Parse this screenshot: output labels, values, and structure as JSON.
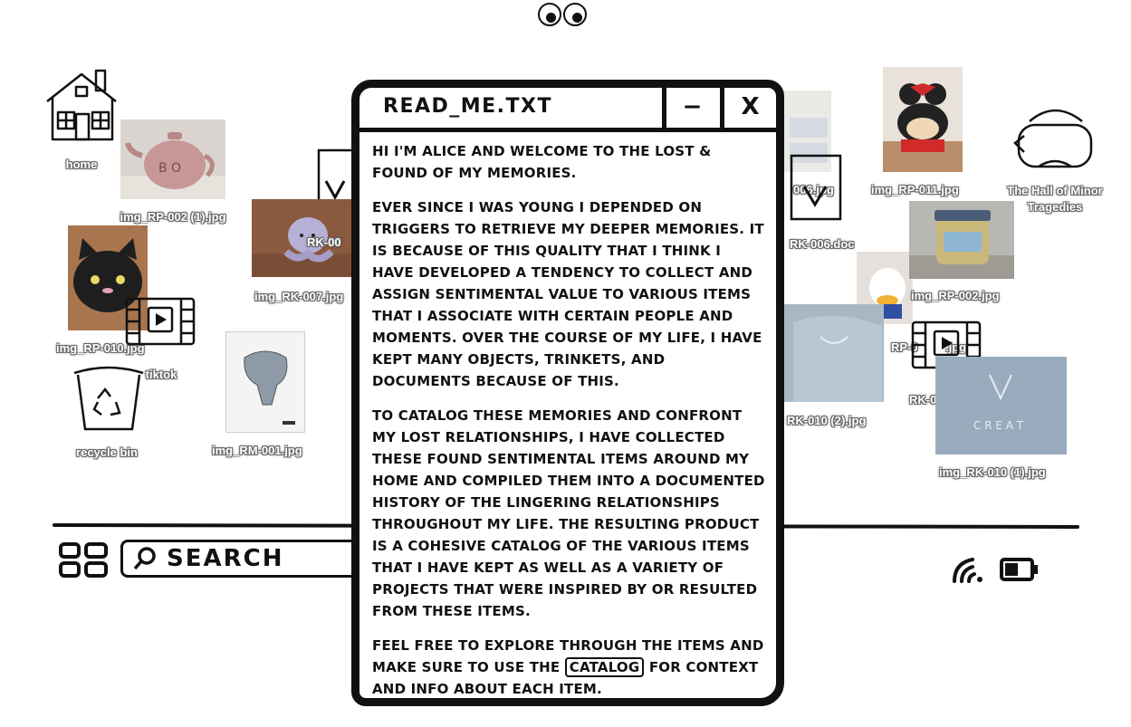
{
  "desktop": {
    "icons": {
      "home": "home",
      "img_rp_002_1": "img_RP-002 (1).jpg",
      "rk_005": "RK-00",
      "img_rk_007": "img_RK-007.jpg",
      "img_rp_010": "img_RP-010.jpg",
      "tiktok": "tiktok",
      "recycle_bin": "recycle bin",
      "img_rm_001": "img_RM-001.jpg",
      "rk_006_jpg": "006.jpg",
      "rk_006_doc": "RK-006.doc",
      "img_rp_011": "img_RP-011.jpg",
      "hall_minor_tragedies": "The Hall of Minor Tragedies",
      "img_rp_002": "img_RP-002.jpg",
      "rp_partial": "RP-0",
      "rp_partial_suffix": ".jpg",
      "rk_009": "RK-009.mp4",
      "img_rk_010_2": "RK-010 (2).jpg",
      "img_rk_010_1": "img_RK-010 (1).jpg"
    }
  },
  "taskbar": {
    "search_label": "SEARCH"
  },
  "window": {
    "title": "READ_ME.TXT",
    "minimize_label": "−",
    "close_label": "X",
    "paragraphs": [
      "Hi I'm Alice and welcome to the Lost & Found of my memories.",
      "Ever since I was young I depended on triggers to retrieve my deeper memories. It is because of this quality that I think I have developed a tendency to collect and assign sentimental value to various items that I associate with certain people and moments. Over the course of my life, I have kept many objects, trinkets, and documents because of this.",
      "To catalog these memories and confront my lost relationships, I have collected these found sentimental items around my home and compiled them into a documented history of the lingering relationships throughout my life. The resulting product is a cohesive catalog of the various items that I have kept as well as a variety of projects that were inspired by or resulted from these items."
    ],
    "closing_before": "Feel free to explore through the items and make sure to use the",
    "closing_link": "catalog",
    "closing_after": "for context and info about each item."
  }
}
